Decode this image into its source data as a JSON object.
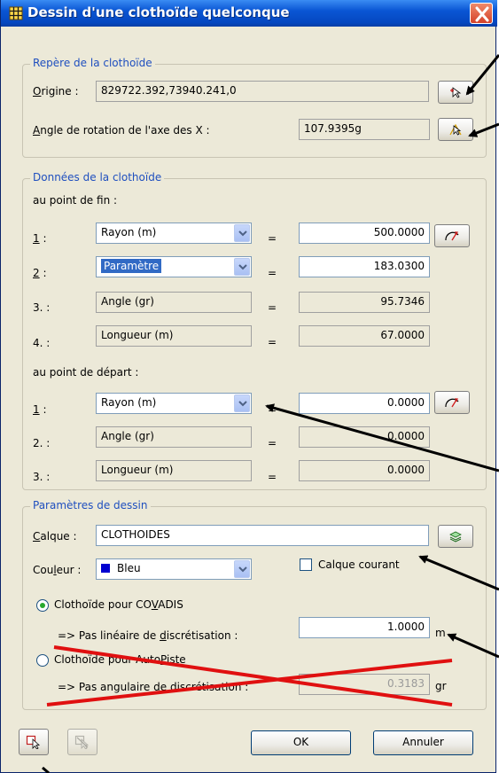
{
  "window": {
    "title": "Dessin d'une clothoïde quelconque"
  },
  "repere": {
    "legend": "Repère de la clothoïde",
    "origine_label_u": "O",
    "origine_label_rest": "rigine :",
    "origine_value": "829722.392,73940.241,0",
    "angle_label_u": "A",
    "angle_label_rest": "ngle de rotation de l'axe des X :",
    "angle_value": "107.9395g"
  },
  "donnees": {
    "legend": "Données de la clothoïde",
    "fin_title": "au point de fin :",
    "depart_title": "au point de départ :",
    "equals": "=",
    "fin_rows": [
      {
        "num": "1",
        "suffix": " :",
        "type": "Rayon (m)",
        "value": "500.0000"
      },
      {
        "num": "2",
        "suffix": " :",
        "type": "Paramètre",
        "value": "183.0300"
      },
      {
        "num": "3.",
        "suffix": " :",
        "type": "Angle (gr)",
        "value": "95.7346"
      },
      {
        "num": "4.",
        "suffix": " :",
        "type": "Longueur (m)",
        "value": "67.0000"
      }
    ],
    "depart_rows": [
      {
        "num": "1",
        "suffix": " :",
        "type": "Rayon (m)",
        "value": "0.0000"
      },
      {
        "num": "2.",
        "suffix": " :",
        "type": "Angle (gr)",
        "value": "0.0000"
      },
      {
        "num": "3.",
        "suffix": " :",
        "type": "Longueur (m)",
        "value": "0.0000"
      }
    ]
  },
  "dessin": {
    "legend": "Paramètres de dessin",
    "calque_label_u": "C",
    "calque_label_rest": "alque :",
    "calque_value": "CLOTHOIDES",
    "couleur_label_pre": "Cou",
    "couleur_label_u": "l",
    "couleur_label_rest": "eur :",
    "couleur_value": "Bleu",
    "couleur_color": "#0000d0",
    "calque_courant_label": "Calque courant",
    "covadis_label_pre": "Clothoïde pour CO",
    "covadis_label_u": "V",
    "covadis_label_rest": "ADIS",
    "pas_lineaire_pre": "=> Pas linéaire de ",
    "pas_lineaire_u": "d",
    "pas_lineaire_rest": "iscrétisation :",
    "pas_lineaire_value": "1.0000",
    "pas_lineaire_unit": "m",
    "autopiste_label_pre": "Clothoïde pour Auto",
    "autopiste_label_u": "P",
    "autopiste_label_rest": "iste",
    "pas_angulaire_pre": "=> Pas angulaire de ",
    "pas_angulaire_u": "d",
    "pas_angulaire_rest": "iscrétisation :",
    "pas_angulaire_value": "0.3183",
    "pas_angulaire_unit": "gr"
  },
  "footer": {
    "ok_label": "OK",
    "cancel_label": "Annuler"
  },
  "colors": {
    "annotation_arrow": "#000000",
    "annotation_cross": "#e01010"
  }
}
